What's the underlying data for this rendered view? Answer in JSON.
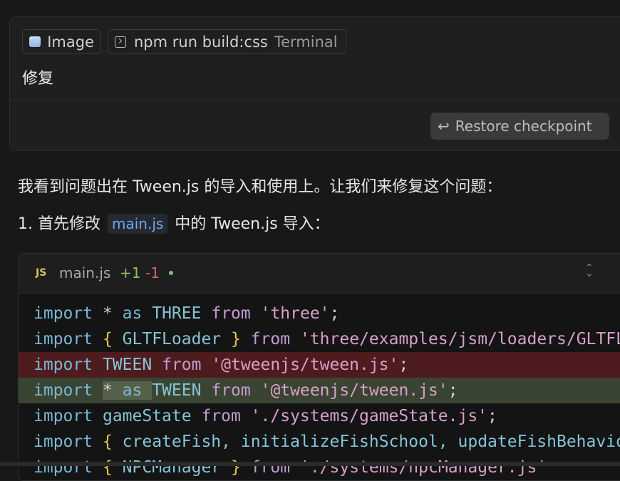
{
  "user_card": {
    "chips": {
      "image_label": "Image",
      "terminal_command": "npm run build:css",
      "terminal_label": "Terminal"
    },
    "message": "修复",
    "restore_label": "Restore checkpoint"
  },
  "assistant": {
    "para1": "我看到问题出在 Tween.js 的导入和使用上。让我们来修复这个问题：",
    "para2_prefix": "1. 首先修改",
    "para2_code": "main.js",
    "para2_suffix": "中的 Tween.js 导入："
  },
  "diff": {
    "file_icon": "JS",
    "file_name": "main.js",
    "added": "+1",
    "removed": "-1",
    "lines": {
      "l1": {
        "import": "import",
        "star": "*",
        "as": "as",
        "name": "THREE",
        "from": "from",
        "src": "'three'",
        "end": ";"
      },
      "l2": {
        "import": "import",
        "open": "{",
        "name": "GLTFLoader",
        "close": "}",
        "from": "from",
        "src": "'three/examples/jsm/loaders/GLTFLoader.js'"
      },
      "l3": {
        "import": "import",
        "name": "TWEEN",
        "from": "from",
        "src": "'@tweenjs/tween.js'",
        "end": ";"
      },
      "l4": {
        "import": "import",
        "star": "*",
        "as": "as",
        "name": "TWEEN",
        "from": "from",
        "src": "'@tweenjs/tween.js'",
        "end": ";"
      },
      "l5": {
        "import": "import",
        "name": "gameState",
        "from": "from",
        "src": "'./systems/gameState.js'",
        "end": ";"
      },
      "l6": {
        "import": "import",
        "open": "{",
        "names": "createFish,",
        "names2": "initializeFishSchool,",
        "names3": "updateFishBehavior"
      },
      "l7": {
        "import": "import",
        "open": "{",
        "name": "NPCManager",
        "close": "}",
        "from": "from",
        "src": "'./systems/npcManager.js'"
      }
    }
  }
}
